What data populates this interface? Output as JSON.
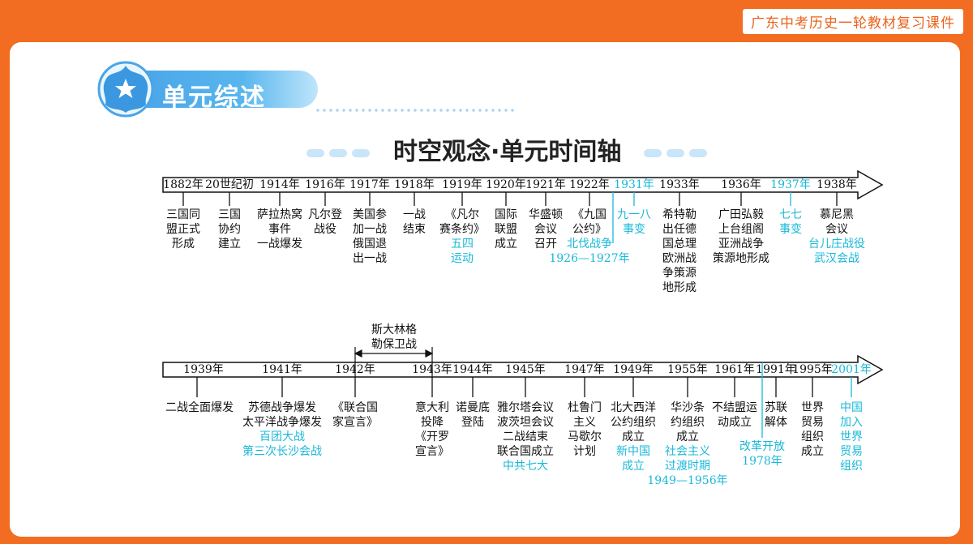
{
  "brand": "广东中考历史一轮教材复习课件",
  "section_title": "单元综述",
  "subtitle": "时空观念·单元时间轴",
  "colors": {
    "accent": "#f26d21",
    "cyan": "#19b9d8",
    "blue": "#4aa4e8"
  },
  "bracket_label": [
    "斯大林格",
    "勒保卫战"
  ],
  "row1_years": [
    "1882年",
    "20世纪初",
    "1914年",
    "1916年",
    "1917年",
    "1918年",
    "1919年",
    "1920年",
    "1921年",
    "1922年",
    "1931年",
    "1933年",
    "1936年",
    "1937年",
    "1938年"
  ],
  "row1_events": [
    {
      "lines": [
        "三国同",
        "盟正式",
        "形成"
      ]
    },
    {
      "lines": [
        "三国",
        "协约",
        "建立"
      ]
    },
    {
      "lines": [
        "萨拉热窝",
        "事件",
        "一战爆发"
      ]
    },
    {
      "lines": [
        "凡尔登",
        "战役"
      ]
    },
    {
      "lines": [
        "美国参",
        "加一战",
        "俄国退",
        "出一战"
      ]
    },
    {
      "lines": [
        "一战",
        "结束"
      ]
    },
    {
      "lines": [
        "《凡尔",
        "赛条约》"
      ],
      "cyan": [
        "五四",
        "运动"
      ]
    },
    {
      "lines": [
        "国际",
        "联盟",
        "成立"
      ]
    },
    {
      "lines": [
        "华盛顿",
        "会议",
        "召开"
      ]
    },
    {
      "lines": [
        "《九国",
        "公约》"
      ],
      "cyan": [
        "北伐战争",
        "1926—1927年"
      ]
    },
    {
      "cyan": [
        "九一八",
        "事变"
      ]
    },
    {
      "lines": [
        "希特勒",
        "出任德",
        "国总理",
        "欧洲战",
        "争策源",
        "地形成"
      ]
    },
    {
      "lines": [
        "广田弘毅",
        "上台组阁",
        "亚洲战争",
        "策源地形成"
      ]
    },
    {
      "cyan": [
        "七七",
        "事变"
      ]
    },
    {
      "lines": [
        "慕尼黑",
        "会议"
      ],
      "cyan": [
        "台儿庄战役",
        "武汉会战"
      ]
    }
  ],
  "row2_years": [
    "1939年",
    "1941年",
    "1942年",
    "1943年",
    "1944年",
    "1945年",
    "1947年",
    "1949年",
    "1955年",
    "1961年",
    "1991年",
    "1995年",
    "2001年"
  ],
  "row2_events": [
    {
      "lines": [
        "二战全面爆发"
      ]
    },
    {
      "lines": [
        "苏德战争爆发",
        "太平洋战争爆发"
      ],
      "cyan": [
        "百团大战",
        "第三次长沙会战"
      ]
    },
    {
      "lines": [
        "《联合国",
        "家宣言》"
      ]
    },
    {
      "lines": [
        "意大利",
        "投降",
        "《开罗",
        "宣言》"
      ]
    },
    {
      "lines": [
        "诺曼底",
        "登陆"
      ]
    },
    {
      "lines": [
        "雅尔塔会议",
        "波茨坦会议",
        "二战结束",
        "联合国成立"
      ],
      "cyan": [
        "中共七大"
      ]
    },
    {
      "lines": [
        "杜鲁门",
        "主义",
        "马歇尔",
        "计划"
      ]
    },
    {
      "lines": [
        "北大西洋",
        "公约组织",
        "成立"
      ],
      "cyan": [
        "新中国",
        "成立"
      ]
    },
    {
      "lines": [
        "华沙条",
        "约组织",
        "成立"
      ],
      "cyan": [
        "社会主义",
        "过渡时期",
        "1949—1956年"
      ]
    },
    {
      "lines": [
        "不结盟运",
        "动成立"
      ]
    },
    {
      "cyan": [
        "改革开放",
        "1978年"
      ]
    },
    {
      "lines": [
        "苏联",
        "解体"
      ]
    },
    {
      "lines": [
        "世界",
        "贸易",
        "组织",
        "成立"
      ]
    },
    {
      "cyan": [
        "中国",
        "加入",
        "世界",
        "贸易",
        "组织"
      ]
    }
  ]
}
